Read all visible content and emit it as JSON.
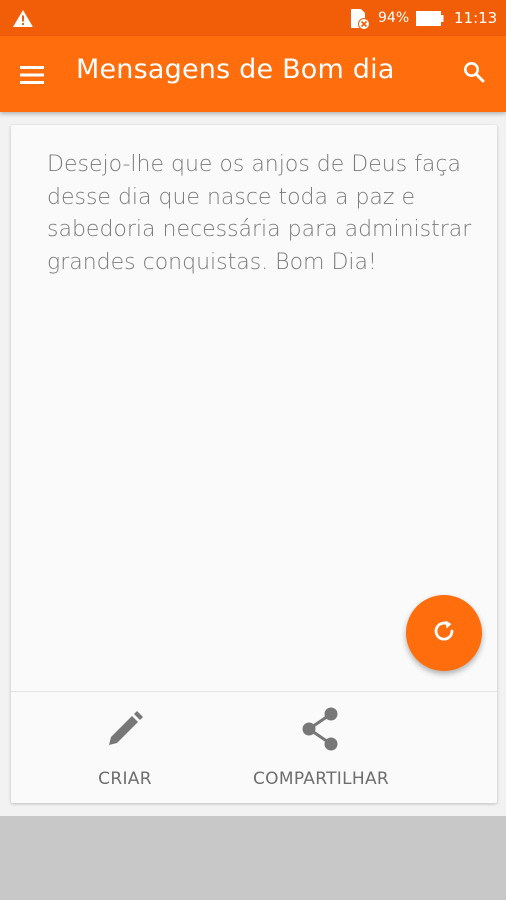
{
  "status_bar": {
    "battery_percent": "94%",
    "time": "11:13",
    "icons": [
      "warning-icon",
      "sd-card-icon",
      "battery-icon"
    ]
  },
  "app_bar": {
    "title": "Mensagens de Bom dia",
    "icons": [
      "menu-icon",
      "search-icon"
    ],
    "color": "#ff6d0c",
    "status_color": "#f25e08"
  },
  "card": {
    "message": "Desejo-lhe que os anjos de Deus faça desse dia que nasce toda a paz e sabedoria necessária para administrar grandes conquistas. Bom Dia!",
    "fab_icon": "refresh-icon",
    "actions": [
      {
        "label": "CRIAR",
        "icon": "pencil-icon"
      },
      {
        "label": "COMPARTILHAR",
        "icon": "share-icon"
      }
    ]
  }
}
